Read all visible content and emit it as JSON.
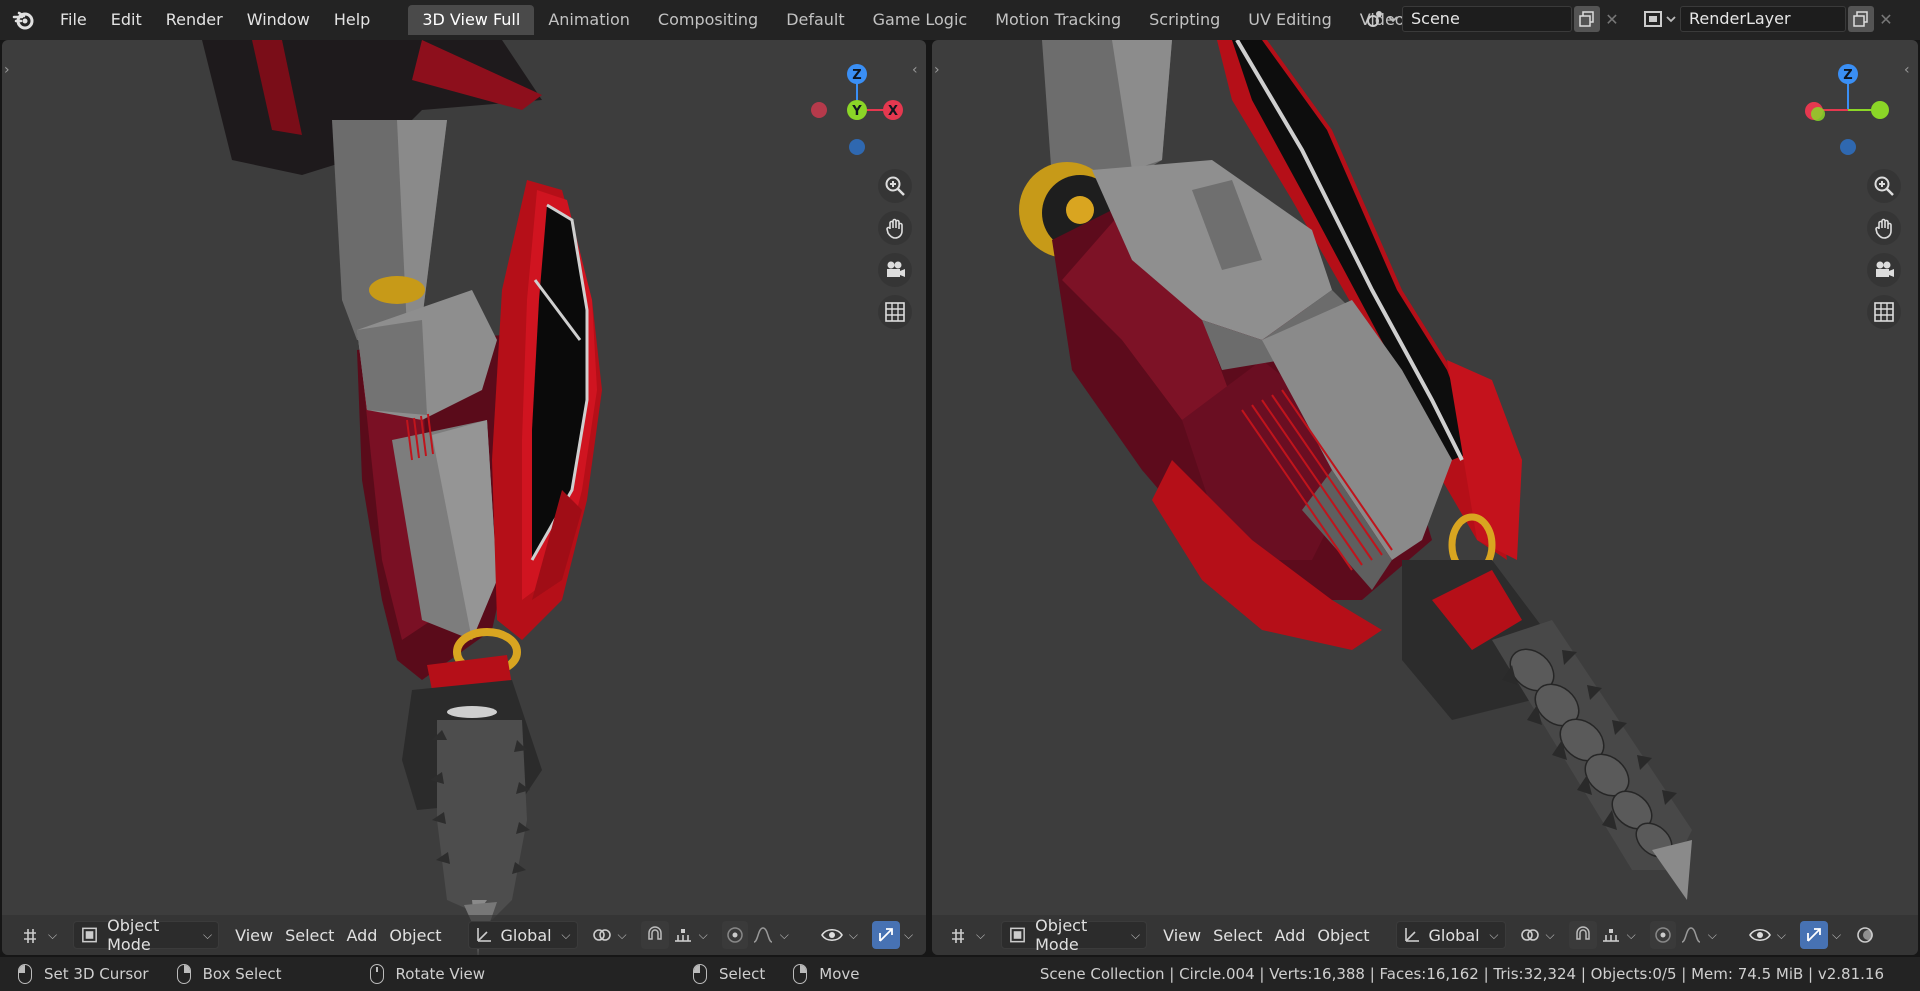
{
  "topbar": {
    "menu": [
      "File",
      "Edit",
      "Render",
      "Window",
      "Help"
    ],
    "workspaces": [
      "3D View Full",
      "Animation",
      "Compositing",
      "Default",
      "Game Logic",
      "Motion Tracking",
      "Scripting",
      "UV Editing",
      "Video Editing"
    ],
    "active_workspace": "3D View Full",
    "scene": {
      "value": "Scene"
    },
    "render_layer": {
      "value": "RenderLayer"
    }
  },
  "viewport_header": {
    "mode": "Object Mode",
    "menus": [
      "View",
      "Select",
      "Add",
      "Object"
    ],
    "orientation": "Global"
  },
  "gizmo_left": {
    "z": "Z",
    "y": "Y",
    "x": "X"
  },
  "gizmo_right": {
    "z": "Z"
  },
  "statusbar": {
    "hints": [
      {
        "icon": "mouse-left-icon",
        "label": "Set 3D Cursor"
      },
      {
        "icon": "mouse-right-icon",
        "label": "Box Select"
      },
      {
        "icon": "mouse-middle-icon",
        "label": "Rotate View"
      },
      {
        "icon": "mouse-left-icon",
        "label": "Select"
      },
      {
        "icon": "mouse-right-icon",
        "label": "Move"
      }
    ],
    "stats": "Scene Collection | Circle.004 | Verts:16,388 | Faces:16,162 | Tris:32,324 | Objects:0/5 | Mem: 74.5 MiB | v2.81.16"
  },
  "colors": {
    "accent": "#4772b3",
    "axis_x": "#e5384f",
    "axis_y": "#8bd627",
    "axis_z": "#3a8ff5",
    "model_red": "#c4121c",
    "model_darkred": "#6e0d1f",
    "model_grey": "#8c8c8c",
    "model_gold": "#d9a520"
  }
}
